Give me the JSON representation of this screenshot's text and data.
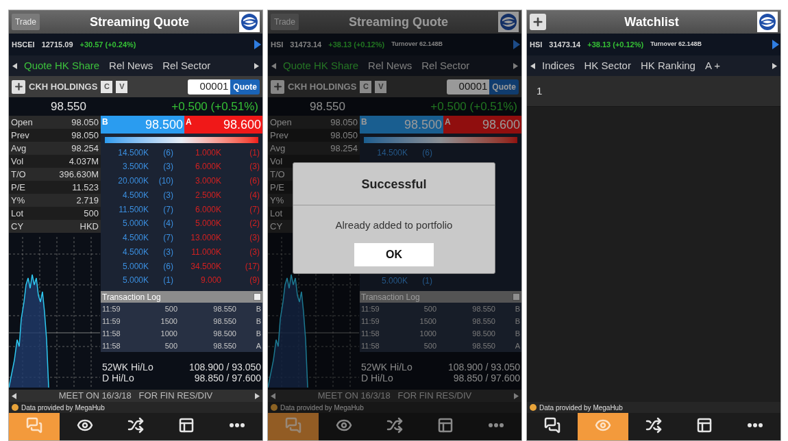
{
  "screens": [
    {
      "kind": "quote",
      "dimmed": false,
      "header": {
        "left_button": "Trade",
        "title": "Streaming Quote"
      },
      "ticker": [
        {
          "index": "HSCEI",
          "value": "12715.09",
          "change": "+30.57 (+0.24%)"
        }
      ],
      "tabs": [
        {
          "label": "Quote HK Share",
          "selected": true
        },
        {
          "label": "Rel News",
          "selected": false
        },
        {
          "label": "Rel Sector",
          "selected": false
        }
      ],
      "stock": {
        "name": "CKH HOLDINGS",
        "buttons": [
          "C",
          "V"
        ],
        "code": "00001",
        "quote_button": "Quote"
      },
      "price": "98.550",
      "change": "+0.500 (+0.51%)",
      "stats": [
        {
          "label": "Open",
          "value": "98.050"
        },
        {
          "label": "Prev",
          "value": "98.050"
        },
        {
          "label": "Avg",
          "value": "98.254"
        },
        {
          "label": "Vol",
          "value": "4.037M"
        },
        {
          "label": "T/O",
          "value": "396.630M"
        },
        {
          "label": "P/E",
          "value": "11.523"
        },
        {
          "label": "Y%",
          "value": "2.719"
        },
        {
          "label": "Lot",
          "value": "500"
        },
        {
          "label": "CY",
          "value": "HKD"
        }
      ],
      "bid": {
        "tag": "B",
        "price": "98.500"
      },
      "ask": {
        "tag": "A",
        "price": "98.600"
      },
      "book": [
        {
          "bid_qty": "14.500K",
          "bid_count": "(6)",
          "ask_qty": "1.000K",
          "ask_count": "(1)"
        },
        {
          "bid_qty": "3.500K",
          "bid_count": "(3)",
          "ask_qty": "6.000K",
          "ask_count": "(3)"
        },
        {
          "bid_qty": "20.000K",
          "bid_count": "(10)",
          "ask_qty": "3.000K",
          "ask_count": "(6)"
        },
        {
          "bid_qty": "4.500K",
          "bid_count": "(3)",
          "ask_qty": "2.500K",
          "ask_count": "(4)"
        },
        {
          "bid_qty": "11.500K",
          "bid_count": "(7)",
          "ask_qty": "6.000K",
          "ask_count": "(7)"
        },
        {
          "bid_qty": "5.000K",
          "bid_count": "(4)",
          "ask_qty": "5.000K",
          "ask_count": "(2)"
        },
        {
          "bid_qty": "4.500K",
          "bid_count": "(7)",
          "ask_qty": "13.000K",
          "ask_count": "(3)"
        },
        {
          "bid_qty": "4.500K",
          "bid_count": "(3)",
          "ask_qty": "11.000K",
          "ask_count": "(3)"
        },
        {
          "bid_qty": "5.000K",
          "bid_count": "(6)",
          "ask_qty": "34.500K",
          "ask_count": "(17)"
        },
        {
          "bid_qty": "5.000K",
          "bid_count": "(1)",
          "ask_qty": "9.000",
          "ask_count": "(9)"
        }
      ],
      "log": {
        "title": "Transaction Log",
        "rows": [
          {
            "time": "11:59",
            "qty": "500",
            "price": "98.550",
            "side": "B"
          },
          {
            "time": "11:59",
            "qty": "1500",
            "price": "98.550",
            "side": "B"
          },
          {
            "time": "11:58",
            "qty": "1000",
            "price": "98.500",
            "side": "B"
          },
          {
            "time": "11:58",
            "qty": "500",
            "price": "98.550",
            "side": "A"
          }
        ]
      },
      "ranges": [
        {
          "label": "52WK Hi/Lo",
          "value": "108.900 / 93.050"
        },
        {
          "label": "D Hi/Lo",
          "value": "98.850 / 97.600"
        }
      ],
      "marquee": "MEET ON 16/3/18   FOR FIN RES/DIV",
      "credit": "Data provided by MegaHub",
      "nav": [
        {
          "kind": "chat",
          "selected": true
        },
        {
          "kind": "eye",
          "selected": false
        },
        {
          "kind": "shuffle",
          "selected": false
        },
        {
          "kind": "panel",
          "selected": false
        },
        {
          "kind": "more",
          "selected": false
        }
      ]
    },
    {
      "kind": "quote",
      "dimmed": true,
      "header": {
        "left_button": "Trade",
        "title": "Streaming Quote"
      },
      "ticker": [
        {
          "index": "HSI",
          "value": "31473.14",
          "change": "+38.13 (+0.12%)",
          "turnover": "Turnover 62.148B"
        }
      ],
      "tabs": [
        {
          "label": "Quote HK Share",
          "selected": true
        },
        {
          "label": "Rel News",
          "selected": false
        },
        {
          "label": "Rel Sector",
          "selected": false
        }
      ],
      "stock": {
        "name": "CKH HOLDINGS",
        "buttons": [
          "C",
          "V"
        ],
        "code": "00001",
        "quote_button": "Quote"
      },
      "price": "98.550",
      "change": "+0.500 (+0.51%)",
      "stats": [
        {
          "label": "Open",
          "value": "98.050"
        },
        {
          "label": "Prev",
          "value": "98.050"
        },
        {
          "label": "Avg",
          "value": "98.254"
        },
        {
          "label": "Vol"
        },
        {
          "label": "T/O"
        },
        {
          "label": "P/E"
        },
        {
          "label": "Y%"
        },
        {
          "label": "Lot"
        },
        {
          "label": "CY"
        }
      ],
      "bid": {
        "tag": "B",
        "price": "98.500"
      },
      "ask": {
        "tag": "A",
        "price": "98.600"
      },
      "book": [
        {
          "bid_qty": "14.500K",
          "bid_count": "(6)"
        },
        {
          "bid_qty": "5.000K",
          "bid_count": "(1)"
        }
      ],
      "log": {
        "title": "Transaction Log",
        "rows": [
          {
            "time": "11:59",
            "qty": "500",
            "price": "98.550",
            "side": "B"
          },
          {
            "time": "11:59",
            "qty": "1500",
            "price": "98.550",
            "side": "B"
          },
          {
            "time": "11:58",
            "qty": "1000",
            "price": "98.500",
            "side": "B"
          },
          {
            "time": "11:58",
            "qty": "500",
            "price": "98.550",
            "side": "A"
          }
        ]
      },
      "ranges": [
        {
          "label": "52WK Hi/Lo",
          "value": "108.900 / 93.050"
        },
        {
          "label": "D Hi/Lo",
          "value": "98.850 / 97.600"
        }
      ],
      "marquee": "MEET ON 16/3/18   FOR FIN RES/DIV",
      "credit": "Data provided by MegaHub",
      "nav": [
        {
          "kind": "chat",
          "selected": true
        },
        {
          "kind": "eye",
          "selected": false
        },
        {
          "kind": "shuffle",
          "selected": false
        },
        {
          "kind": "panel",
          "selected": false
        },
        {
          "kind": "more",
          "selected": false
        }
      ],
      "dialog": {
        "title": "Successful",
        "message": "Already added to portfolio",
        "button": "OK"
      }
    },
    {
      "kind": "watchlist",
      "dimmed": false,
      "header": {
        "title": "Watchlist"
      },
      "ticker": [
        {
          "index": "HSI",
          "value": "31473.14",
          "change": "+38.13 (+0.12%)",
          "turnover": "Turnover 62.148B"
        }
      ],
      "tabs": [
        {
          "label": "Indices",
          "selected": false
        },
        {
          "label": "HK Sector",
          "selected": false
        },
        {
          "label": "HK Ranking",
          "selected": false
        },
        {
          "label": "A +",
          "selected": false
        }
      ],
      "rows": [
        {
          "label": "1"
        }
      ],
      "credit": "Data provided by MegaHub",
      "nav": [
        {
          "kind": "chat",
          "selected": false
        },
        {
          "kind": "eye",
          "selected": true
        },
        {
          "kind": "shuffle",
          "selected": false
        },
        {
          "kind": "panel",
          "selected": false
        },
        {
          "kind": "more",
          "selected": false
        }
      ]
    }
  ]
}
